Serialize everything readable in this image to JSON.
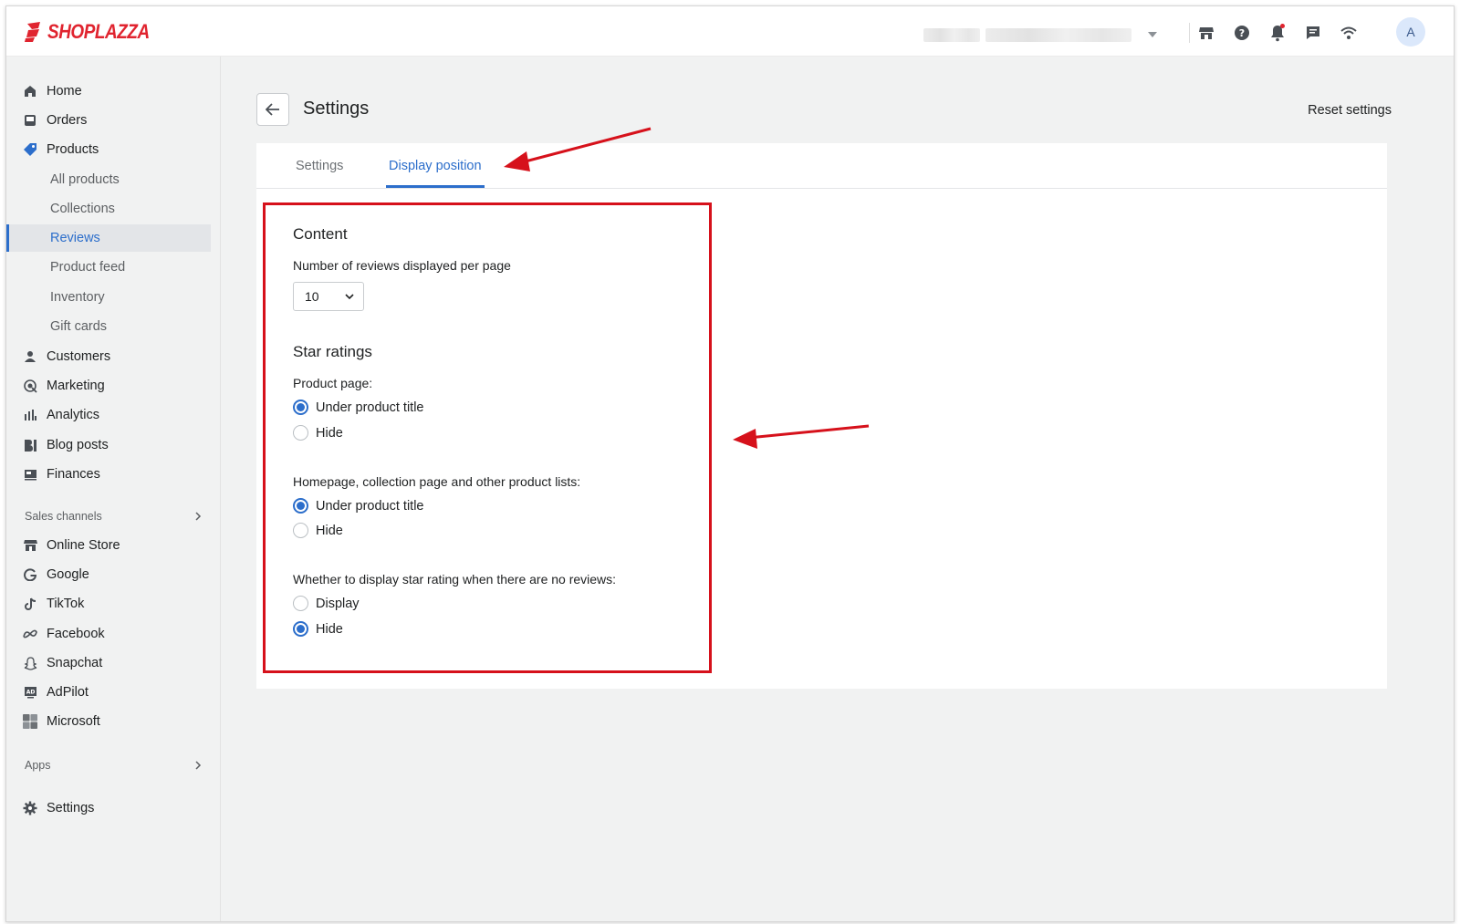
{
  "brand": {
    "name": "SHOPLAZZA",
    "color": "#e0242f"
  },
  "topbar": {
    "icons": [
      "store-icon",
      "help-icon",
      "bell-icon",
      "chat-icon",
      "wifi-icon"
    ],
    "avatar_letter": "A"
  },
  "sidebar": {
    "items": [
      {
        "label": "Home",
        "icon": "home-icon"
      },
      {
        "label": "Orders",
        "icon": "inbox-icon"
      },
      {
        "label": "Products",
        "icon": "tag-icon"
      }
    ],
    "product_sub": [
      "All products",
      "Collections",
      "Reviews",
      "Product feed",
      "Inventory",
      "Gift cards"
    ],
    "items2": [
      {
        "label": "Customers",
        "icon": "person-icon"
      },
      {
        "label": "Marketing",
        "icon": "target-icon"
      },
      {
        "label": "Analytics",
        "icon": "bars-icon"
      },
      {
        "label": "Blog posts",
        "icon": "blog-icon"
      },
      {
        "label": "Finances",
        "icon": "finance-icon"
      }
    ],
    "sales_channels_label": "Sales channels",
    "channels": [
      {
        "label": "Online Store",
        "icon": "store-icon"
      },
      {
        "label": "Google",
        "icon": "google-icon"
      },
      {
        "label": "TikTok",
        "icon": "tiktok-icon"
      },
      {
        "label": "Facebook",
        "icon": "meta-icon"
      },
      {
        "label": "Snapchat",
        "icon": "snapchat-icon"
      },
      {
        "label": "AdPilot",
        "icon": "ad-icon"
      },
      {
        "label": "Microsoft",
        "icon": "microsoft-icon"
      }
    ],
    "apps_label": "Apps",
    "settings_label": "Settings",
    "active_sub": "Reviews",
    "accent": "#2c6ecb"
  },
  "page": {
    "title": "Settings",
    "reset_label": "Reset settings",
    "tabs": [
      {
        "label": "Settings",
        "active": false
      },
      {
        "label": "Display position",
        "active": true
      }
    ]
  },
  "content": {
    "heading": "Content",
    "reviews_per_page_label": "Number of reviews displayed per page",
    "reviews_per_page_value": "10",
    "star_heading": "Star ratings",
    "product_page_label": "Product page:",
    "product_page_options": [
      {
        "label": "Under product title",
        "checked": true
      },
      {
        "label": "Hide",
        "checked": false
      }
    ],
    "lists_label": "Homepage, collection page and other product lists:",
    "lists_options": [
      {
        "label": "Under product title",
        "checked": true
      },
      {
        "label": "Hide",
        "checked": false
      }
    ],
    "no_reviews_label": "Whether to display star rating when there are no reviews:",
    "no_reviews_options": [
      {
        "label": "Display",
        "checked": false
      },
      {
        "label": "Hide",
        "checked": true
      }
    ]
  },
  "annotation_color": "#d6111b"
}
